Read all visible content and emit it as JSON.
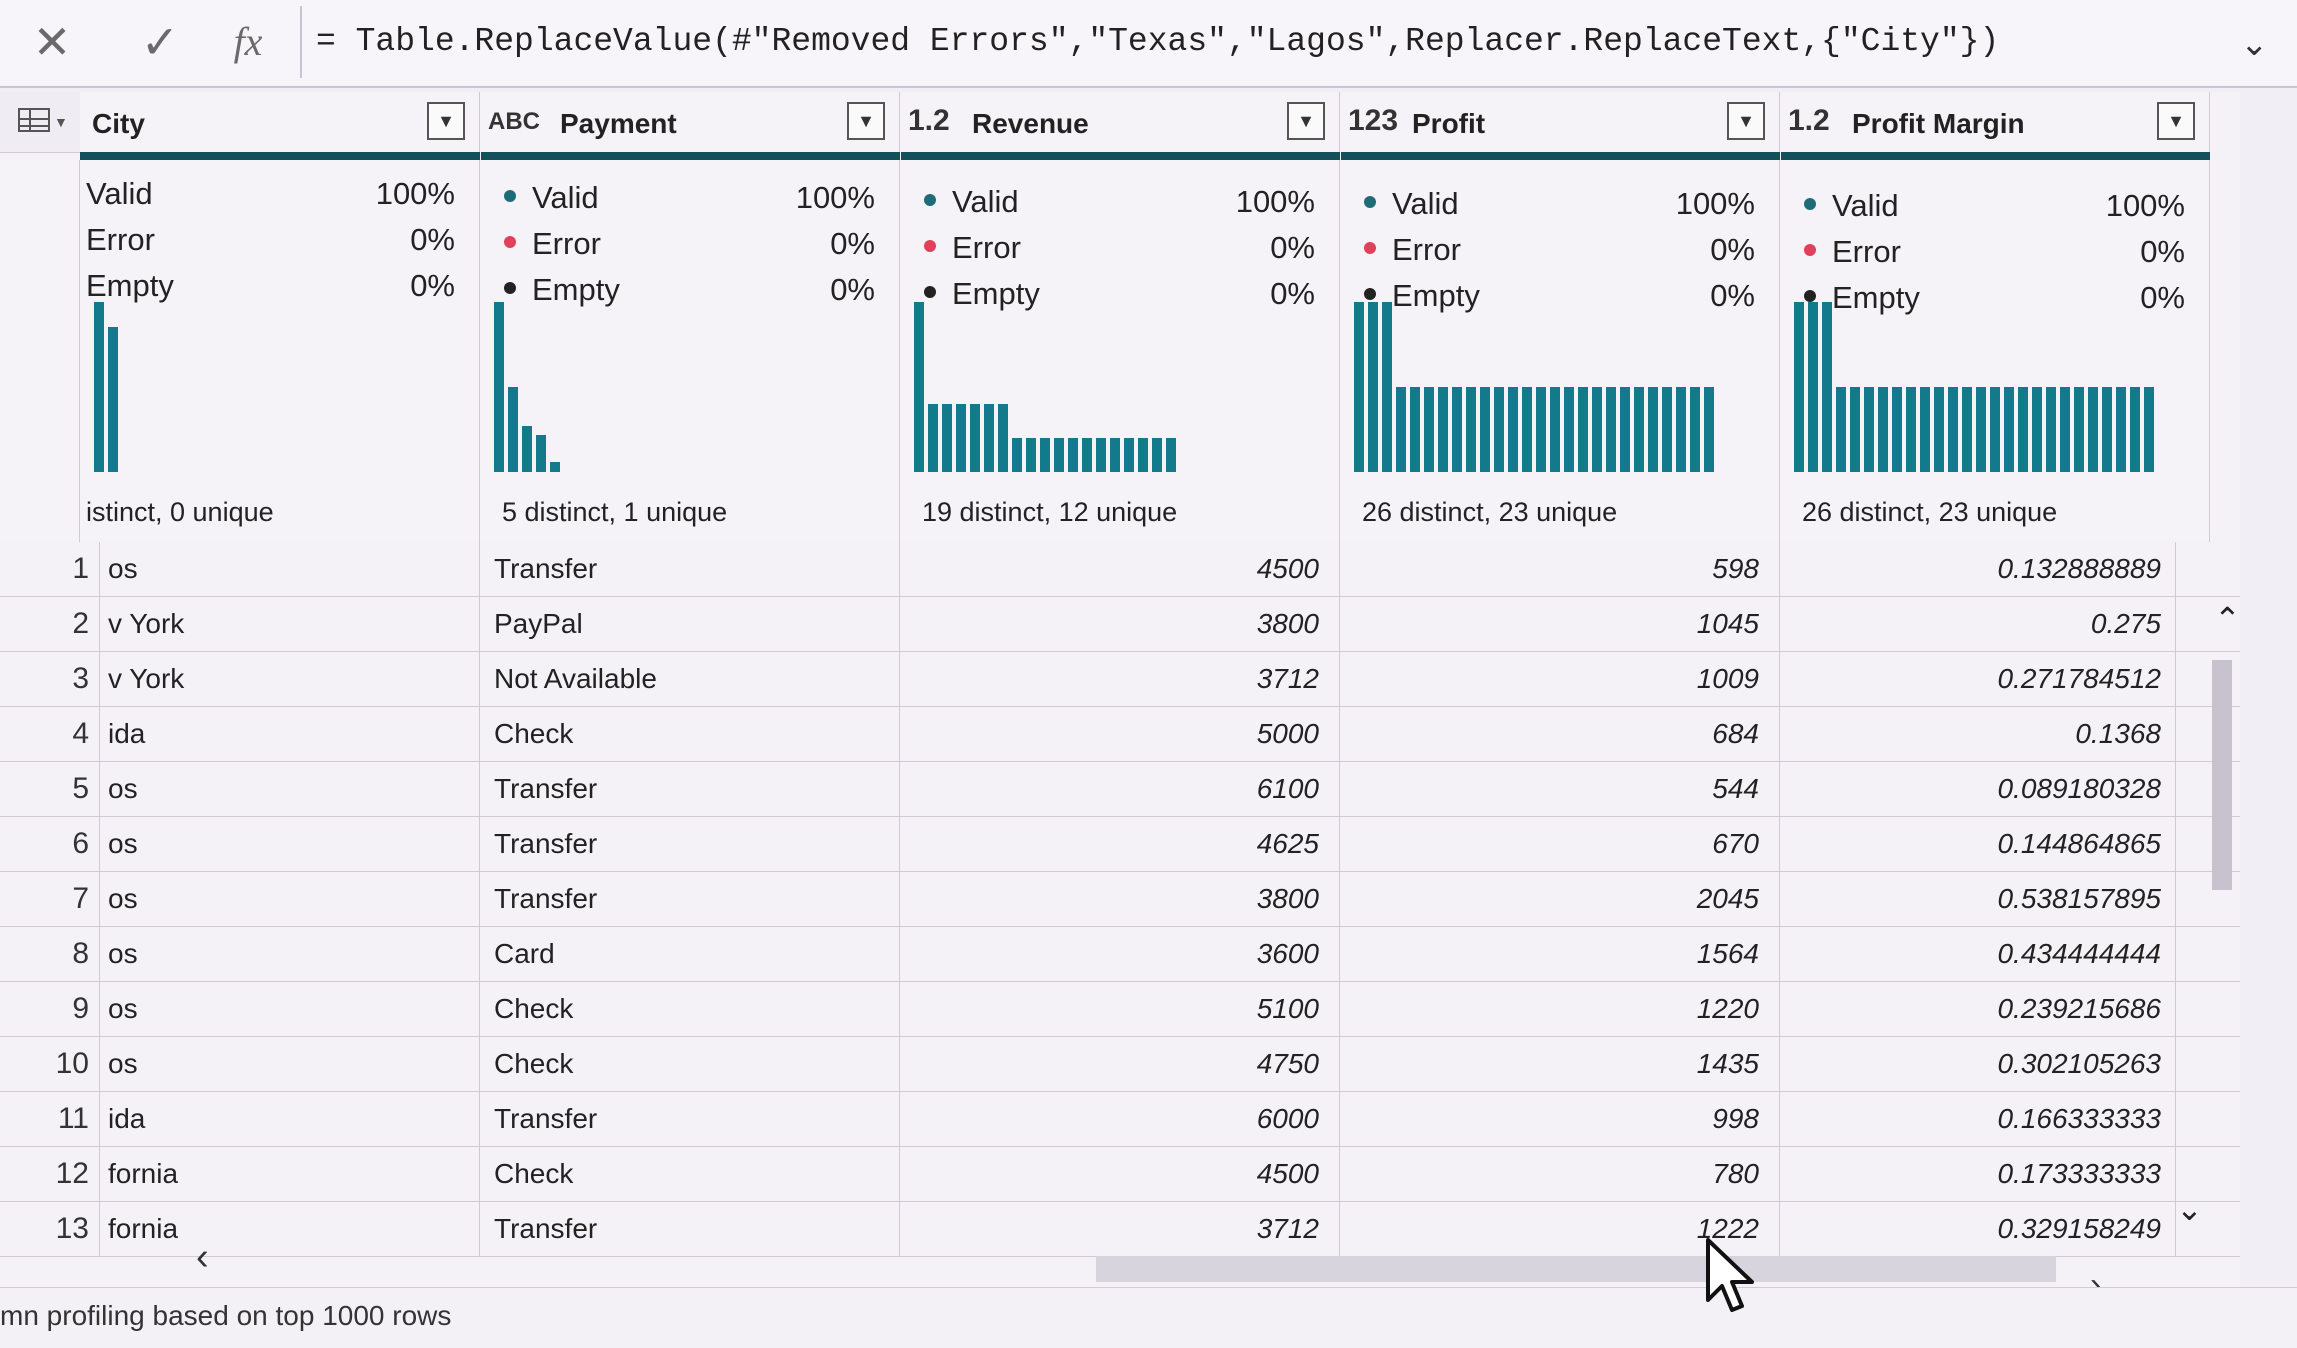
{
  "formula_bar": {
    "cancel_icon": "close-icon",
    "commit_icon": "check-icon",
    "fx_label": "fx",
    "formula": "= Table.ReplaceValue(#\"Removed Errors\",\"Texas\",\"Lagos\",Replacer.ReplaceText,{\"City\"})"
  },
  "columns": [
    {
      "name": "City",
      "type_icon": "",
      "valid_label": "Valid",
      "valid_pct": "100%",
      "error_label": "Error",
      "error_pct": "0%",
      "empty_label": "Empty",
      "empty_pct": "0%",
      "distinct": "istinct, 0 unique",
      "bars": [
        1.0,
        0.85
      ]
    },
    {
      "name": "Payment",
      "type_icon": "ABC",
      "valid_label": "Valid",
      "valid_pct": "100%",
      "error_label": "Error",
      "error_pct": "0%",
      "empty_label": "Empty",
      "empty_pct": "0%",
      "distinct": "5 distinct, 1 unique",
      "bars": [
        1.0,
        0.5,
        0.27,
        0.22,
        0.06
      ]
    },
    {
      "name": "Revenue",
      "type_icon": "1.2",
      "valid_label": "Valid",
      "valid_pct": "100%",
      "error_label": "Error",
      "error_pct": "0%",
      "empty_label": "Empty",
      "empty_pct": "0%",
      "distinct": "19 distinct, 12 unique",
      "bars": [
        1.0,
        0.4,
        0.4,
        0.4,
        0.4,
        0.4,
        0.4,
        0.2,
        0.2,
        0.2,
        0.2,
        0.2,
        0.2,
        0.2,
        0.2,
        0.2,
        0.2,
        0.2,
        0.2
      ]
    },
    {
      "name": "Profit",
      "type_icon": "123",
      "valid_label": "Valid",
      "valid_pct": "100%",
      "error_label": "Error",
      "error_pct": "0%",
      "empty_label": "Empty",
      "empty_pct": "0%",
      "distinct": "26 distinct, 23 unique",
      "bars": [
        1.0,
        1.0,
        1.0,
        0.5,
        0.5,
        0.5,
        0.5,
        0.5,
        0.5,
        0.5,
        0.5,
        0.5,
        0.5,
        0.5,
        0.5,
        0.5,
        0.5,
        0.5,
        0.5,
        0.5,
        0.5,
        0.5,
        0.5,
        0.5,
        0.5,
        0.5
      ]
    },
    {
      "name": "Profit Margin",
      "type_icon": "1.2",
      "valid_label": "Valid",
      "valid_pct": "100%",
      "error_label": "Error",
      "error_pct": "0%",
      "empty_label": "Empty",
      "empty_pct": "0%",
      "distinct": "26 distinct, 23 unique",
      "bars": [
        1.0,
        1.0,
        1.0,
        0.5,
        0.5,
        0.5,
        0.5,
        0.5,
        0.5,
        0.5,
        0.5,
        0.5,
        0.5,
        0.5,
        0.5,
        0.5,
        0.5,
        0.5,
        0.5,
        0.5,
        0.5,
        0.5,
        0.5,
        0.5,
        0.5,
        0.5
      ]
    }
  ],
  "rows": [
    {
      "n": "1",
      "city": "os",
      "payment": "Transfer",
      "revenue": "4500",
      "profit": "598",
      "margin": "0.132888889"
    },
    {
      "n": "2",
      "city": "v York",
      "payment": "PayPal",
      "revenue": "3800",
      "profit": "1045",
      "margin": "0.275"
    },
    {
      "n": "3",
      "city": "v York",
      "payment": "Not Available",
      "revenue": "3712",
      "profit": "1009",
      "margin": "0.271784512"
    },
    {
      "n": "4",
      "city": "ida",
      "payment": "Check",
      "revenue": "5000",
      "profit": "684",
      "margin": "0.1368"
    },
    {
      "n": "5",
      "city": "os",
      "payment": "Transfer",
      "revenue": "6100",
      "profit": "544",
      "margin": "0.089180328"
    },
    {
      "n": "6",
      "city": "os",
      "payment": "Transfer",
      "revenue": "4625",
      "profit": "670",
      "margin": "0.144864865"
    },
    {
      "n": "7",
      "city": "os",
      "payment": "Transfer",
      "revenue": "3800",
      "profit": "2045",
      "margin": "0.538157895"
    },
    {
      "n": "8",
      "city": "os",
      "payment": "Card",
      "revenue": "3600",
      "profit": "1564",
      "margin": "0.434444444"
    },
    {
      "n": "9",
      "city": "os",
      "payment": "Check",
      "revenue": "5100",
      "profit": "1220",
      "margin": "0.239215686"
    },
    {
      "n": "10",
      "city": "os",
      "payment": "Check",
      "revenue": "4750",
      "profit": "1435",
      "margin": "0.302105263"
    },
    {
      "n": "11",
      "city": "ida",
      "payment": "Transfer",
      "revenue": "6000",
      "profit": "998",
      "margin": "0.166333333"
    },
    {
      "n": "12",
      "city": "fornia",
      "payment": "Check",
      "revenue": "4500",
      "profit": "780",
      "margin": "0.173333333"
    },
    {
      "n": "13",
      "city": "fornia",
      "payment": "Transfer",
      "revenue": "3712",
      "profit": "1222",
      "margin": "0.329158249"
    }
  ],
  "status": {
    "text": "mn profiling based on top 1000 rows"
  },
  "colors": {
    "accent_teal": "#13505b",
    "bar_teal": "#127a8a",
    "valid_dot": "#1d6c78",
    "error_dot": "#e0405a",
    "empty_dot": "#222222"
  }
}
